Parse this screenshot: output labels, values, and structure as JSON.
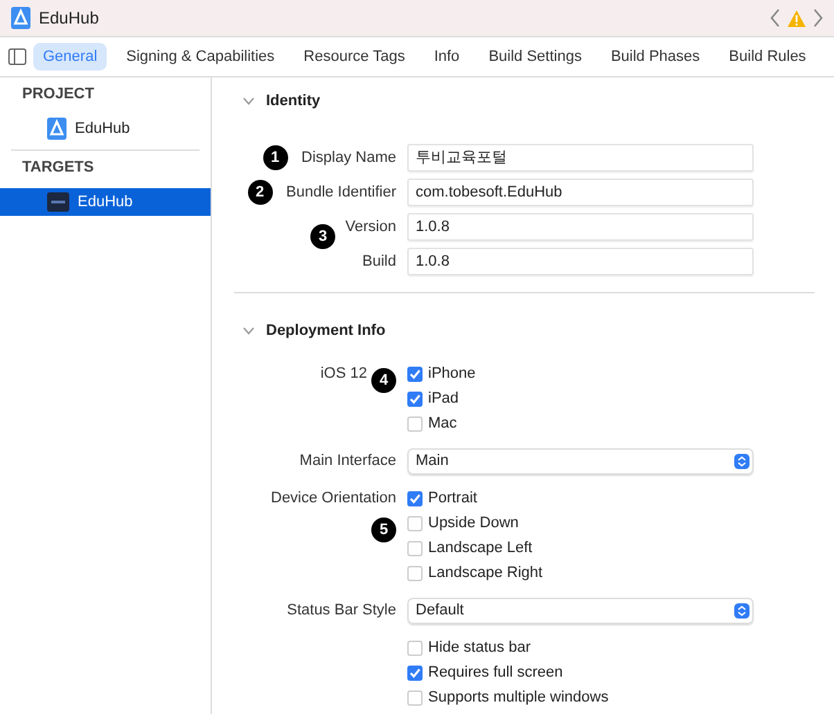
{
  "window": {
    "title": "EduHub"
  },
  "tabs": [
    {
      "label": "General",
      "selected": true
    },
    {
      "label": "Signing & Capabilities",
      "selected": false
    },
    {
      "label": "Resource Tags",
      "selected": false
    },
    {
      "label": "Info",
      "selected": false
    },
    {
      "label": "Build Settings",
      "selected": false
    },
    {
      "label": "Build Phases",
      "selected": false
    },
    {
      "label": "Build Rules",
      "selected": false
    }
  ],
  "sidebar": {
    "sections": [
      {
        "title": "PROJECT",
        "items": [
          {
            "label": "EduHub",
            "kind": "project",
            "selected": false
          }
        ]
      },
      {
        "title": "TARGETS",
        "items": [
          {
            "label": "EduHub",
            "kind": "target",
            "selected": true
          }
        ]
      }
    ]
  },
  "sections": [
    {
      "title": "Identity",
      "expanded": true,
      "rows": [
        {
          "kind": "field",
          "label": "Display Name",
          "value": "투비교육포털",
          "callout": {
            "number": "1",
            "kind": "before"
          }
        },
        {
          "kind": "field",
          "label": "Bundle Identifier",
          "value": "com.tobesoft.EduHub",
          "callout": {
            "number": "2",
            "kind": "before"
          }
        },
        {
          "kind": "field",
          "label": "Version",
          "value": "1.0.8",
          "callout": {
            "number": "3",
            "kind": "below"
          }
        },
        {
          "kind": "field",
          "label": "Build",
          "value": "1.0.8"
        }
      ]
    },
    {
      "title": "Deployment Info",
      "expanded": true,
      "rows": [
        {
          "kind": "checkbox",
          "label": "iOS 12",
          "text": "iPhone",
          "checked": true,
          "callout": {
            "number": "4",
            "kind": "overlay"
          }
        },
        {
          "kind": "checkbox",
          "text": "iPad",
          "checked": true
        },
        {
          "kind": "checkbox",
          "text": "Mac",
          "checked": false
        },
        {
          "kind": "select",
          "label": "Main Interface",
          "value": "Main"
        },
        {
          "kind": "checkbox",
          "label": "Device Orientation",
          "text": "Portrait",
          "checked": true
        },
        {
          "kind": "checkbox",
          "text": "Upside Down",
          "checked": false,
          "callout": {
            "number": "5",
            "kind": "overlay"
          }
        },
        {
          "kind": "checkbox",
          "text": "Landscape Left",
          "checked": false
        },
        {
          "kind": "checkbox",
          "text": "Landscape Right",
          "checked": false
        },
        {
          "kind": "select",
          "label": "Status Bar Style",
          "value": "Default"
        },
        {
          "kind": "checkbox",
          "text": "Hide status bar",
          "checked": false
        },
        {
          "kind": "checkbox",
          "text": "Requires full screen",
          "checked": true
        },
        {
          "kind": "checkbox",
          "text": "Supports multiple windows",
          "checked": false
        }
      ]
    }
  ]
}
